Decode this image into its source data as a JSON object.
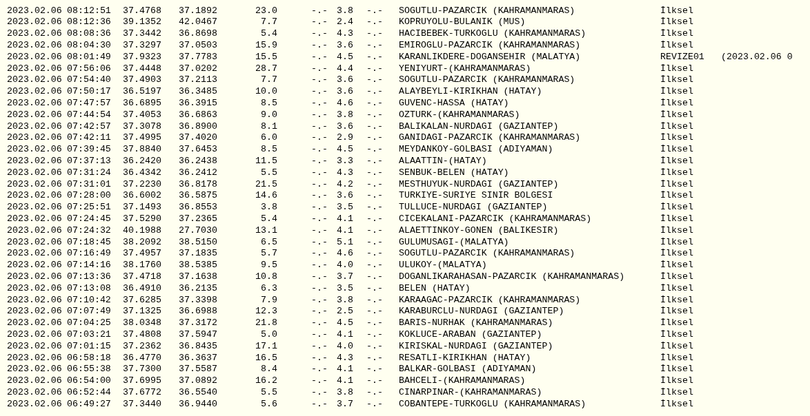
{
  "table": {
    "rows": [
      {
        "date": "2023.02.06",
        "time": "08:12:51",
        "latitude": "37.4768",
        "longitude": "37.1892",
        "depth": "23.0",
        "md": "-.-",
        "ml": "3.8",
        "mw": "-.-",
        "location": "SOGUTLU-PAZARCIK (KAHRAMANMARAS)",
        "status": "İlksel"
      },
      {
        "date": "2023.02.06",
        "time": "08:12:36",
        "latitude": "39.1352",
        "longitude": "42.0467",
        "depth": "7.7",
        "md": "-.-",
        "ml": "2.4",
        "mw": "-.-",
        "location": "KOPRUYOLU-BULANIK (MUS)",
        "status": "İlksel"
      },
      {
        "date": "2023.02.06",
        "time": "08:08:36",
        "latitude": "37.3442",
        "longitude": "36.8698",
        "depth": "5.4",
        "md": "-.-",
        "ml": "4.3",
        "mw": "-.-",
        "location": "HACIBEBEK-TURKOGLU (KAHRAMANMARAS)",
        "status": "İlksel"
      },
      {
        "date": "2023.02.06",
        "time": "08:04:30",
        "latitude": "37.3297",
        "longitude": "37.0503",
        "depth": "15.9",
        "md": "-.-",
        "ml": "3.6",
        "mw": "-.-",
        "location": "EMIROGLU-PAZARCIK (KAHRAMANMARAS)",
        "status": "İlksel"
      },
      {
        "date": "2023.02.06",
        "time": "08:01:49",
        "latitude": "37.9323",
        "longitude": "37.7783",
        "depth": "15.5",
        "md": "-.-",
        "ml": "4.5",
        "mw": "-.-",
        "location": "KARANLIKDERE-DOGANSEHIR (MALATYA)",
        "status": "REVIZE01",
        "note": "(2023.02.06 0"
      },
      {
        "date": "2023.02.06",
        "time": "07:56:06",
        "latitude": "37.4448",
        "longitude": "37.0202",
        "depth": "28.7",
        "md": "-.-",
        "ml": "4.4",
        "mw": "-.-",
        "location": "YENIYURT-(KAHRAMANMARAS)",
        "status": "İlksel"
      },
      {
        "date": "2023.02.06",
        "time": "07:54:40",
        "latitude": "37.4903",
        "longitude": "37.2113",
        "depth": "7.7",
        "md": "-.-",
        "ml": "3.6",
        "mw": "-.-",
        "location": "SOGUTLU-PAZARCIK (KAHRAMANMARAS)",
        "status": "İlksel"
      },
      {
        "date": "2023.02.06",
        "time": "07:50:17",
        "latitude": "36.5197",
        "longitude": "36.3485",
        "depth": "10.0",
        "md": "-.-",
        "ml": "3.6",
        "mw": "-.-",
        "location": "ALAYBEYLI-KIRIKHAN (HATAY)",
        "status": "İlksel"
      },
      {
        "date": "2023.02.06",
        "time": "07:47:57",
        "latitude": "36.6895",
        "longitude": "36.3915",
        "depth": "8.5",
        "md": "-.-",
        "ml": "4.6",
        "mw": "-.-",
        "location": "GUVENC-HASSA (HATAY)",
        "status": "İlksel"
      },
      {
        "date": "2023.02.06",
        "time": "07:44:54",
        "latitude": "37.4053",
        "longitude": "36.6863",
        "depth": "9.0",
        "md": "-.-",
        "ml": "3.8",
        "mw": "-.-",
        "location": "OZTURK-(KAHRAMANMARAS)",
        "status": "İlksel"
      },
      {
        "date": "2023.02.06",
        "time": "07:42:57",
        "latitude": "37.3078",
        "longitude": "36.8900",
        "depth": "8.1",
        "md": "-.-",
        "ml": "3.6",
        "mw": "-.-",
        "location": "BALIKALAN-NURDAGI (GAZIANTEP)",
        "status": "İlksel"
      },
      {
        "date": "2023.02.06",
        "time": "07:42:11",
        "latitude": "37.4995",
        "longitude": "37.4020",
        "depth": "6.0",
        "md": "-.-",
        "ml": "2.9",
        "mw": "-.-",
        "location": "GANIDAGI-PAZARCIK (KAHRAMANMARAS)",
        "status": "İlksel"
      },
      {
        "date": "2023.02.06",
        "time": "07:39:45",
        "latitude": "37.8840",
        "longitude": "37.6453",
        "depth": "8.5",
        "md": "-.-",
        "ml": "4.5",
        "mw": "-.-",
        "location": "MEYDANKOY-GOLBASI (ADIYAMAN)",
        "status": "İlksel"
      },
      {
        "date": "2023.02.06",
        "time": "07:37:13",
        "latitude": "36.2420",
        "longitude": "36.2438",
        "depth": "11.5",
        "md": "-.-",
        "ml": "3.3",
        "mw": "-.-",
        "location": "ALAATTIN-(HATAY)",
        "status": "İlksel"
      },
      {
        "date": "2023.02.06",
        "time": "07:31:24",
        "latitude": "36.4342",
        "longitude": "36.2412",
        "depth": "5.5",
        "md": "-.-",
        "ml": "4.3",
        "mw": "-.-",
        "location": "SENBUK-BELEN (HATAY)",
        "status": "İlksel"
      },
      {
        "date": "2023.02.06",
        "time": "07:31:01",
        "latitude": "37.2230",
        "longitude": "36.8178",
        "depth": "21.5",
        "md": "-.-",
        "ml": "4.2",
        "mw": "-.-",
        "location": "MESTHUYUK-NURDAGI (GAZIANTEP)",
        "status": "İlksel"
      },
      {
        "date": "2023.02.06",
        "time": "07:28:00",
        "latitude": "36.6002",
        "longitude": "36.5875",
        "depth": "14.6",
        "md": "-.-",
        "ml": "3.6",
        "mw": "-.-",
        "location": "TURKIYE-SURIYE SINIR BOLGESI",
        "status": "İlksel"
      },
      {
        "date": "2023.02.06",
        "time": "07:25:51",
        "latitude": "37.1493",
        "longitude": "36.8553",
        "depth": "3.8",
        "md": "-.-",
        "ml": "3.5",
        "mw": "-.-",
        "location": "TULLUCE-NURDAGI (GAZIANTEP)",
        "status": "İlksel"
      },
      {
        "date": "2023.02.06",
        "time": "07:24:45",
        "latitude": "37.5290",
        "longitude": "37.2365",
        "depth": "5.4",
        "md": "-.-",
        "ml": "4.1",
        "mw": "-.-",
        "location": "CICEKALANI-PAZARCIK (KAHRAMANMARAS)",
        "status": "İlksel"
      },
      {
        "date": "2023.02.06",
        "time": "07:24:32",
        "latitude": "40.1988",
        "longitude": "27.7030",
        "depth": "13.1",
        "md": "-.-",
        "ml": "4.1",
        "mw": "-.-",
        "location": "ALAETTINKOY-GONEN (BALIKESIR)",
        "status": "İlksel"
      },
      {
        "date": "2023.02.06",
        "time": "07:18:45",
        "latitude": "38.2092",
        "longitude": "38.5150",
        "depth": "6.5",
        "md": "-.-",
        "ml": "5.1",
        "mw": "-.-",
        "location": "GULUMUSAGI-(MALATYA)",
        "status": "İlksel"
      },
      {
        "date": "2023.02.06",
        "time": "07:16:49",
        "latitude": "37.4957",
        "longitude": "37.1835",
        "depth": "5.7",
        "md": "-.-",
        "ml": "4.6",
        "mw": "-.-",
        "location": "SOGUTLU-PAZARCIK (KAHRAMANMARAS)",
        "status": "İlksel"
      },
      {
        "date": "2023.02.06",
        "time": "07:14:16",
        "latitude": "38.1760",
        "longitude": "38.5385",
        "depth": "9.5",
        "md": "-.-",
        "ml": "4.0",
        "mw": "-.-",
        "location": "ULUKOY-(MALATYA)",
        "status": "İlksel"
      },
      {
        "date": "2023.02.06",
        "time": "07:13:36",
        "latitude": "37.4718",
        "longitude": "37.1638",
        "depth": "10.8",
        "md": "-.-",
        "ml": "3.7",
        "mw": "-.-",
        "location": "DOGANLIKARAHASAN-PAZARCIK (KAHRAMANMARAS)",
        "status": "İlksel"
      },
      {
        "date": "2023.02.06",
        "time": "07:13:08",
        "latitude": "36.4910",
        "longitude": "36.2135",
        "depth": "6.3",
        "md": "-.-",
        "ml": "3.5",
        "mw": "-.-",
        "location": "BELEN (HATAY)",
        "status": "İlksel"
      },
      {
        "date": "2023.02.06",
        "time": "07:10:42",
        "latitude": "37.6285",
        "longitude": "37.3398",
        "depth": "7.9",
        "md": "-.-",
        "ml": "3.8",
        "mw": "-.-",
        "location": "KARAAGAC-PAZARCIK (KAHRAMANMARAS)",
        "status": "İlksel"
      },
      {
        "date": "2023.02.06",
        "time": "07:07:49",
        "latitude": "37.1325",
        "longitude": "36.6988",
        "depth": "12.3",
        "md": "-.-",
        "ml": "2.5",
        "mw": "-.-",
        "location": "KARABURCLU-NURDAGI (GAZIANTEP)",
        "status": "İlksel"
      },
      {
        "date": "2023.02.06",
        "time": "07:04:25",
        "latitude": "38.0348",
        "longitude": "37.3172",
        "depth": "21.8",
        "md": "-.-",
        "ml": "4.5",
        "mw": "-.-",
        "location": "BARIS-NURHAK (KAHRAMANMARAS)",
        "status": "İlksel"
      },
      {
        "date": "2023.02.06",
        "time": "07:03:21",
        "latitude": "37.4808",
        "longitude": "37.5947",
        "depth": "5.0",
        "md": "-.-",
        "ml": "4.1",
        "mw": "-.-",
        "location": "KOKLUCE-ARABAN (GAZIANTEP)",
        "status": "İlksel"
      },
      {
        "date": "2023.02.06",
        "time": "07:01:15",
        "latitude": "37.2362",
        "longitude": "36.8435",
        "depth": "17.1",
        "md": "-.-",
        "ml": "4.0",
        "mw": "-.-",
        "location": "KIRISKAL-NURDAGI (GAZIANTEP)",
        "status": "İlksel"
      },
      {
        "date": "2023.02.06",
        "time": "06:58:18",
        "latitude": "36.4770",
        "longitude": "36.3637",
        "depth": "16.5",
        "md": "-.-",
        "ml": "4.3",
        "mw": "-.-",
        "location": "RESATLI-KIRIKHAN (HATAY)",
        "status": "İlksel"
      },
      {
        "date": "2023.02.06",
        "time": "06:55:38",
        "latitude": "37.7300",
        "longitude": "37.5587",
        "depth": "8.4",
        "md": "-.-",
        "ml": "4.1",
        "mw": "-.-",
        "location": "BALKAR-GOLBASI (ADIYAMAN)",
        "status": "İlksel"
      },
      {
        "date": "2023.02.06",
        "time": "06:54:00",
        "latitude": "37.6995",
        "longitude": "37.0892",
        "depth": "16.2",
        "md": "-.-",
        "ml": "4.1",
        "mw": "-.-",
        "location": "BAHCELI-(KAHRAMANMARAS)",
        "status": "İlksel"
      },
      {
        "date": "2023.02.06",
        "time": "06:52:44",
        "latitude": "37.6772",
        "longitude": "36.5540",
        "depth": "5.5",
        "md": "-.-",
        "ml": "3.8",
        "mw": "-.-",
        "location": "CINARPINAR-(KAHRAMANMARAS)",
        "status": "İlksel"
      },
      {
        "date": "2023.02.06",
        "time": "06:49:27",
        "latitude": "37.3440",
        "longitude": "36.9440",
        "depth": "5.6",
        "md": "-.-",
        "ml": "3.7",
        "mw": "-.-",
        "location": "COBANTEPE-TURKOGLU (KAHRAMANMARAS)",
        "status": "İlksel"
      }
    ]
  }
}
